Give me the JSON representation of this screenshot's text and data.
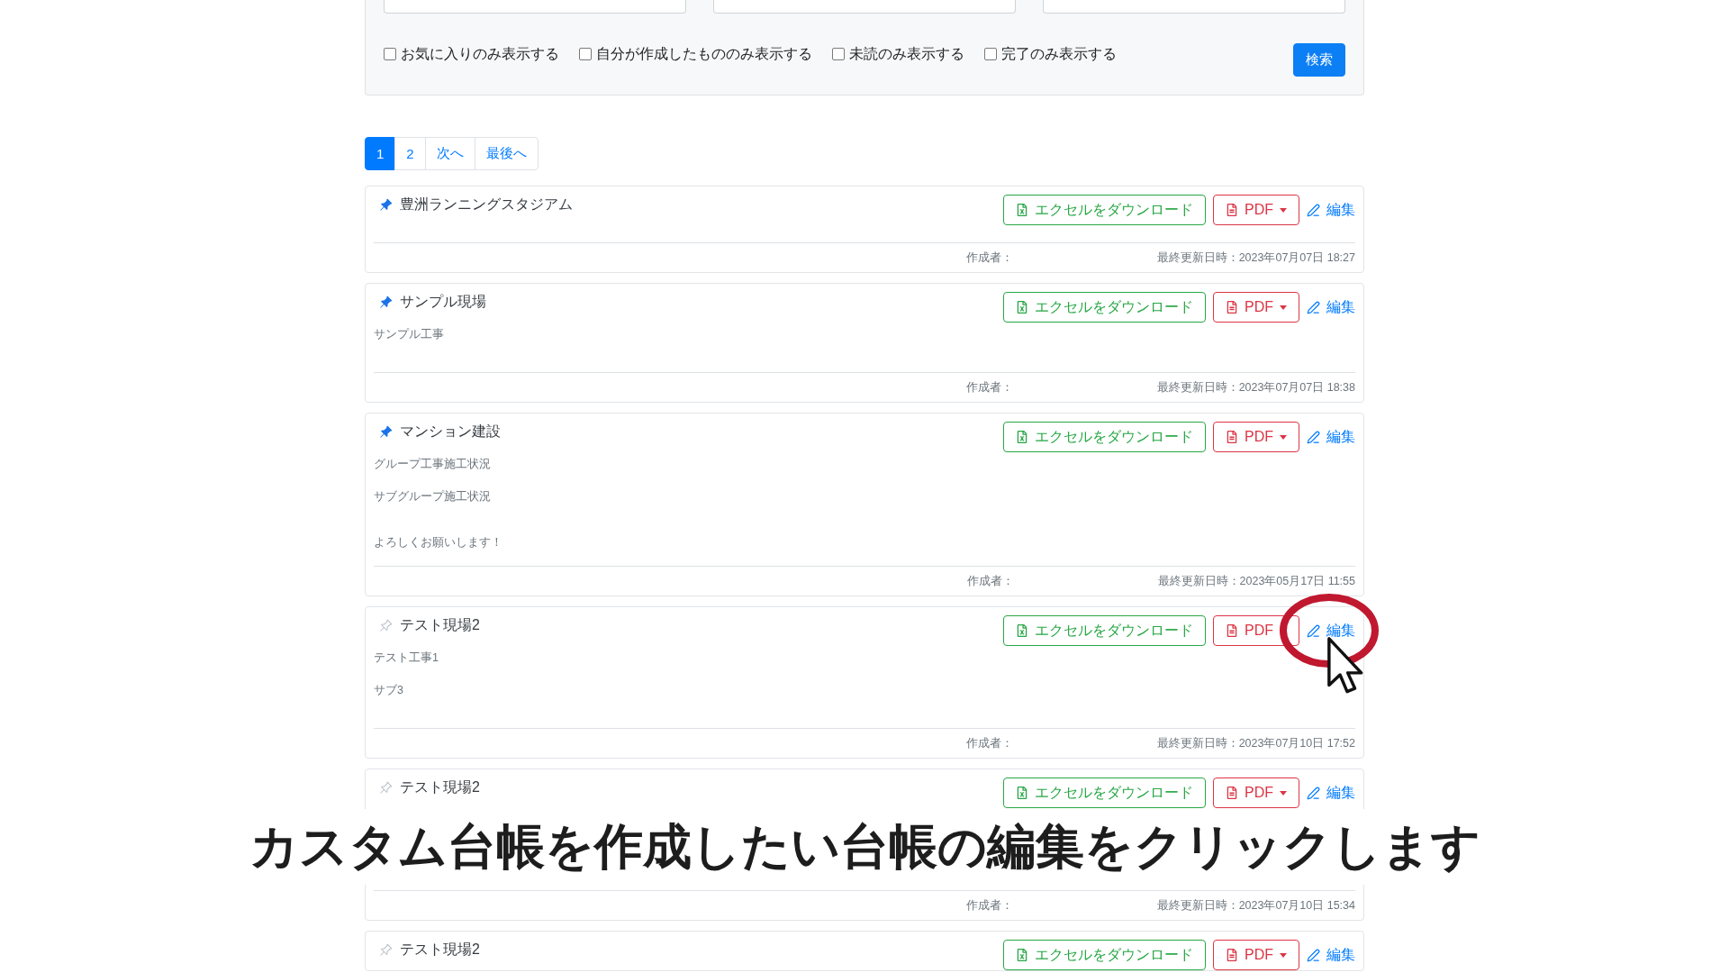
{
  "filters": {
    "checkboxes": [
      {
        "label": "お気に入りのみ表示する",
        "checked": false
      },
      {
        "label": "自分が作成したもののみ表示する",
        "checked": false
      },
      {
        "label": "未読のみ表示する",
        "checked": false
      },
      {
        "label": "完了のみ表示する",
        "checked": false
      }
    ],
    "search_button": "検索"
  },
  "pagination": [
    {
      "label": "1",
      "selected": true
    },
    {
      "label": "2",
      "selected": false
    },
    {
      "label": "次へ",
      "selected": false
    },
    {
      "label": "最後へ",
      "selected": false
    }
  ],
  "cards": [
    {
      "title": "豊洲ランニングスタジアム",
      "pinned": true,
      "excel_button": "エクセルをダウンロード",
      "pdf_button": "PDF",
      "pdf_caret": true,
      "edit_link": "編集",
      "highlighted": false,
      "body_hidden": false,
      "author_label": "作成者：",
      "updated": "最終更新日時：2023年07月07日 18:27"
    },
    {
      "title": "サンプル現場",
      "pinned": true,
      "excel_button": "エクセルをダウンロード",
      "pdf_button": "PDF",
      "pdf_caret": true,
      "edit_link": "編集",
      "highlighted": false,
      "body_hidden": false,
      "details": [
        {
          "kind": "field",
          "text": "サンプル工事"
        }
      ],
      "author_label": "作成者：",
      "updated": "最終更新日時：2023年07月07日 18:38"
    },
    {
      "title": "マンション建設",
      "pinned": true,
      "excel_button": "エクセルをダウンロード",
      "pdf_button": "PDF",
      "pdf_caret": true,
      "edit_link": "編集",
      "highlighted": false,
      "body_hidden": false,
      "details": [
        {
          "kind": "field",
          "text": "グループ工事施工状況"
        },
        {
          "kind": "field",
          "text": "サブグループ施工状況"
        },
        {
          "kind": "memo",
          "text": "よろしくお願いします！"
        }
      ],
      "author_label": "作成者：",
      "updated": "最終更新日時：2023年05月17日 11:55"
    },
    {
      "title": "テスト現場2",
      "pinned": false,
      "excel_button": "エクセルをダウンロード",
      "pdf_button": "PDF",
      "pdf_caret": false,
      "edit_link": "編集",
      "highlighted": true,
      "body_hidden": false,
      "details": [
        {
          "kind": "field",
          "text": "テスト工事1"
        },
        {
          "kind": "field",
          "text": "サブ3"
        }
      ],
      "author_label": "作成者：",
      "updated": "最終更新日時：2023年07月10日 17:52"
    },
    {
      "title": "テスト現場2",
      "pinned": false,
      "excel_button": "エクセルをダウンロード",
      "pdf_button": "PDF",
      "pdf_caret": true,
      "edit_link": "編集",
      "highlighted": false,
      "body_hidden": true,
      "author_label": "作成者：",
      "updated": "最終更新日時：2023年07月10日 15:34"
    },
    {
      "title": "テスト現場2",
      "pinned": false,
      "excel_button": "エクセルをダウンロード",
      "pdf_button": "PDF",
      "pdf_caret": true,
      "edit_link": "編集",
      "highlighted": false,
      "body_hidden": false
    }
  ],
  "caption": "カスタム台帳を作成したい台帳の編集をクリックします"
}
